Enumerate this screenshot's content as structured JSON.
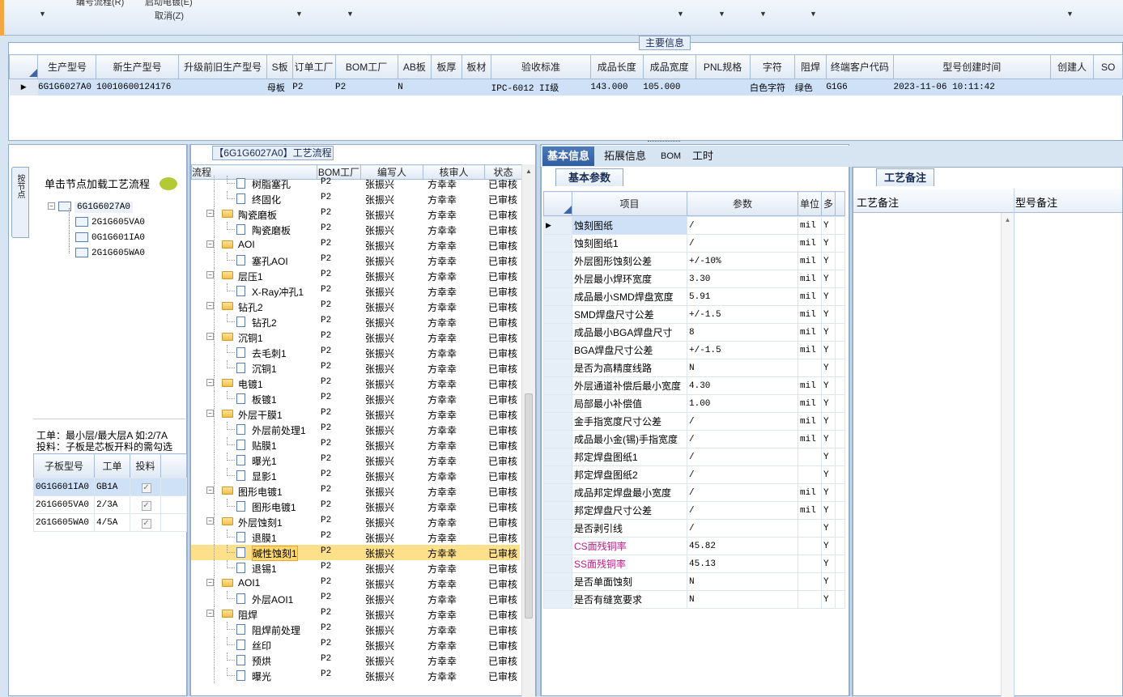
{
  "toolbar": {
    "menu1": "编号流程(R)",
    "menu2": "启动电镀(E)",
    "menu3": "取消(Z)"
  },
  "main_info": {
    "legend": "主要信息",
    "columns": [
      "生产型号",
      "新生产型号",
      "升级前旧生产型号",
      "S板",
      "订单工厂",
      "BOM工厂",
      "AB板",
      "板厚",
      "板材",
      "验收标准",
      "成品长度",
      "成品宽度",
      "PNL规格",
      "字符",
      "阻焊",
      "终端客户代码",
      "型号创建时间",
      "创建人",
      "SO"
    ],
    "row": [
      "6G1G6027A0",
      "10010600124176",
      "",
      "母板",
      "P2",
      "P2",
      "N",
      "",
      "",
      "IPC-6012 II级",
      "143.000",
      "105.000",
      "",
      "白色字符",
      "绿色",
      "G1G6",
      "2023-11-06 10:11:42",
      "",
      ""
    ]
  },
  "left": {
    "vtab": "按节点",
    "load_label": "单击节点加载工艺流程",
    "tree": [
      "6G1G6027A0",
      "2G1G605VA0",
      "0G1G601IA0",
      "2G1G605WA0"
    ],
    "hint1": "工单：最小层/最大层A 如:2/7A",
    "hint2": "投料：子板是芯板开料的需勾选",
    "sub_columns": [
      "子板型号",
      "工单",
      "投料"
    ],
    "sub_rows": [
      [
        "0G1G601IA0",
        "GB1A"
      ],
      [
        "2G1G605VA0",
        "2/3A"
      ],
      [
        "2G1G605WA0",
        "4/5A"
      ]
    ]
  },
  "flow": {
    "title": "【6G1G6027A0】工艺流程",
    "columns": [
      "流程",
      "BOM工厂",
      "编写人",
      "核审人",
      "状态"
    ],
    "rows": [
      {
        "name": "树脂塞孔",
        "kind": "doc",
        "factory": "P2",
        "writer": "张振兴",
        "checker": "方幸幸",
        "status": "已审核"
      },
      {
        "name": "终固化",
        "kind": "doc",
        "factory": "P2",
        "writer": "张振兴",
        "checker": "方幸幸",
        "status": "已审核"
      },
      {
        "name": "陶瓷磨板",
        "kind": "folder",
        "factory": "P2",
        "writer": "张振兴",
        "checker": "方幸幸",
        "status": "已审核"
      },
      {
        "name": "陶瓷磨板",
        "kind": "doc",
        "factory": "P2",
        "writer": "张振兴",
        "checker": "方幸幸",
        "status": "已审核"
      },
      {
        "name": "AOI",
        "kind": "folder",
        "factory": "P2",
        "writer": "张振兴",
        "checker": "方幸幸",
        "status": "已审核"
      },
      {
        "name": "塞孔AOI",
        "kind": "doc",
        "factory": "P2",
        "writer": "张振兴",
        "checker": "方幸幸",
        "status": "已审核"
      },
      {
        "name": "层压1",
        "kind": "folder",
        "factory": "P2",
        "writer": "张振兴",
        "checker": "方幸幸",
        "status": "已审核"
      },
      {
        "name": "X-Ray冲孔1",
        "kind": "doc",
        "factory": "P2",
        "writer": "张振兴",
        "checker": "方幸幸",
        "status": "已审核"
      },
      {
        "name": "钻孔2",
        "kind": "folder",
        "factory": "P2",
        "writer": "张振兴",
        "checker": "方幸幸",
        "status": "已审核"
      },
      {
        "name": "钻孔2",
        "kind": "doc",
        "factory": "P2",
        "writer": "张振兴",
        "checker": "方幸幸",
        "status": "已审核"
      },
      {
        "name": "沉铜1",
        "kind": "folder",
        "factory": "P2",
        "writer": "张振兴",
        "checker": "方幸幸",
        "status": "已审核"
      },
      {
        "name": "去毛刺1",
        "kind": "doc",
        "factory": "P2",
        "writer": "张振兴",
        "checker": "方幸幸",
        "status": "已审核"
      },
      {
        "name": "沉铜1",
        "kind": "doc",
        "factory": "P2",
        "writer": "张振兴",
        "checker": "方幸幸",
        "status": "已审核"
      },
      {
        "name": "电镀1",
        "kind": "folder",
        "factory": "P2",
        "writer": "张振兴",
        "checker": "方幸幸",
        "status": "已审核"
      },
      {
        "name": "板镀1",
        "kind": "doc",
        "factory": "P2",
        "writer": "张振兴",
        "checker": "方幸幸",
        "status": "已审核"
      },
      {
        "name": "外层干膜1",
        "kind": "folder",
        "factory": "P2",
        "writer": "张振兴",
        "checker": "方幸幸",
        "status": "已审核"
      },
      {
        "name": "外层前处理1",
        "kind": "doc",
        "factory": "P2",
        "writer": "张振兴",
        "checker": "方幸幸",
        "status": "已审核"
      },
      {
        "name": "贴膜1",
        "kind": "doc",
        "factory": "P2",
        "writer": "张振兴",
        "checker": "方幸幸",
        "status": "已审核"
      },
      {
        "name": "曝光1",
        "kind": "doc",
        "factory": "P2",
        "writer": "张振兴",
        "checker": "方幸幸",
        "status": "已审核"
      },
      {
        "name": "显影1",
        "kind": "doc",
        "factory": "P2",
        "writer": "张振兴",
        "checker": "方幸幸",
        "status": "已审核"
      },
      {
        "name": "图形电镀1",
        "kind": "folder",
        "factory": "P2",
        "writer": "张振兴",
        "checker": "方幸幸",
        "status": "已审核"
      },
      {
        "name": "图形电镀1",
        "kind": "doc",
        "factory": "P2",
        "writer": "张振兴",
        "checker": "方幸幸",
        "status": "已审核"
      },
      {
        "name": "外层蚀刻1",
        "kind": "folder",
        "factory": "P2",
        "writer": "张振兴",
        "checker": "方幸幸",
        "status": "已审核"
      },
      {
        "name": "退膜1",
        "kind": "doc",
        "factory": "P2",
        "writer": "张振兴",
        "checker": "方幸幸",
        "status": "已审核"
      },
      {
        "name": "碱性蚀刻1",
        "kind": "doc",
        "factory": "P2",
        "writer": "张振兴",
        "checker": "方幸幸",
        "status": "已审核",
        "selected": true
      },
      {
        "name": "退锡1",
        "kind": "doc",
        "factory": "P2",
        "writer": "张振兴",
        "checker": "方幸幸",
        "status": "已审核"
      },
      {
        "name": "AOI1",
        "kind": "folder",
        "factory": "P2",
        "writer": "张振兴",
        "checker": "方幸幸",
        "status": "已审核"
      },
      {
        "name": "外层AOI1",
        "kind": "doc",
        "factory": "P2",
        "writer": "张振兴",
        "checker": "方幸幸",
        "status": "已审核"
      },
      {
        "name": "阻焊",
        "kind": "folder",
        "factory": "P2",
        "writer": "张振兴",
        "checker": "方幸幸",
        "status": "已审核"
      },
      {
        "name": "阻焊前处理",
        "kind": "doc",
        "factory": "P2",
        "writer": "张振兴",
        "checker": "方幸幸",
        "status": "已审核"
      },
      {
        "name": "丝印",
        "kind": "doc",
        "factory": "P2",
        "writer": "张振兴",
        "checker": "方幸幸",
        "status": "已审核"
      },
      {
        "name": "预烘",
        "kind": "doc",
        "factory": "P2",
        "writer": "张振兴",
        "checker": "方幸幸",
        "status": "已审核"
      },
      {
        "name": "曝光",
        "kind": "doc",
        "factory": "P2",
        "writer": "张振兴",
        "checker": "方幸幸",
        "status": "已审核"
      }
    ]
  },
  "detail": {
    "tabs": [
      "基本信息",
      "拓展信息",
      "BOM",
      "工时"
    ],
    "subtab": "基本参数",
    "columns": [
      "项目",
      "参数",
      "单位",
      "多"
    ],
    "rows": [
      {
        "item": "蚀刻图纸",
        "value": "/",
        "unit": "mil",
        "flag": "Y"
      },
      {
        "item": "蚀刻图纸1",
        "value": "/",
        "unit": "mil",
        "flag": "Y"
      },
      {
        "item": "外层图形蚀刻公差",
        "value": "+/-10%",
        "unit": "mil",
        "flag": "Y"
      },
      {
        "item": "外层最小焊环宽度",
        "value": "3.30",
        "unit": "mil",
        "flag": "Y"
      },
      {
        "item": "成品最小SMD焊盘宽度",
        "value": "5.91",
        "unit": "mil",
        "flag": "Y"
      },
      {
        "item": "SMD焊盘尺寸公差",
        "value": "+/-1.5",
        "unit": "mil",
        "flag": "Y"
      },
      {
        "item": "成品最小BGA焊盘尺寸",
        "value": "8",
        "unit": "mil",
        "flag": "Y"
      },
      {
        "item": "BGA焊盘尺寸公差",
        "value": "+/-1.5",
        "unit": "mil",
        "flag": "Y"
      },
      {
        "item": "是否为高精度线路",
        "value": "N",
        "unit": "",
        "flag": "Y"
      },
      {
        "item": "外层通道补偿后最小宽度",
        "value": "4.30",
        "unit": "mil",
        "flag": "Y"
      },
      {
        "item": "局部最小补偿值",
        "value": "1.00",
        "unit": "mil",
        "flag": "Y"
      },
      {
        "item": "金手指宽度尺寸公差",
        "value": "/",
        "unit": "mil",
        "flag": "Y"
      },
      {
        "item": "成品最小金(锡)手指宽度",
        "value": "/",
        "unit": "mil",
        "flag": "Y"
      },
      {
        "item": "邦定焊盘图纸1",
        "value": "/",
        "unit": "",
        "flag": "Y"
      },
      {
        "item": "邦定焊盘图纸2",
        "value": "/",
        "unit": "",
        "flag": "Y"
      },
      {
        "item": "成品邦定焊盘最小宽度",
        "value": "/",
        "unit": "mil",
        "flag": "Y"
      },
      {
        "item": "邦定焊盘尺寸公差",
        "value": "/",
        "unit": "mil",
        "flag": "Y"
      },
      {
        "item": "是否剥引线",
        "value": "/",
        "unit": "",
        "flag": "Y"
      },
      {
        "item": "CS面残铜率",
        "value": "45.82",
        "unit": "",
        "flag": "Y",
        "pink": true
      },
      {
        "item": "SS面残铜率",
        "value": "45.13",
        "unit": "",
        "flag": "Y",
        "pink": true
      },
      {
        "item": "是否单面蚀刻",
        "value": "N",
        "unit": "",
        "flag": "Y"
      },
      {
        "item": "是否有缝宽要求",
        "value": "N",
        "unit": "",
        "flag": "Y"
      }
    ]
  },
  "notes": {
    "tab": "工艺备注",
    "col1": "工艺备注",
    "col2": "型号备注"
  }
}
